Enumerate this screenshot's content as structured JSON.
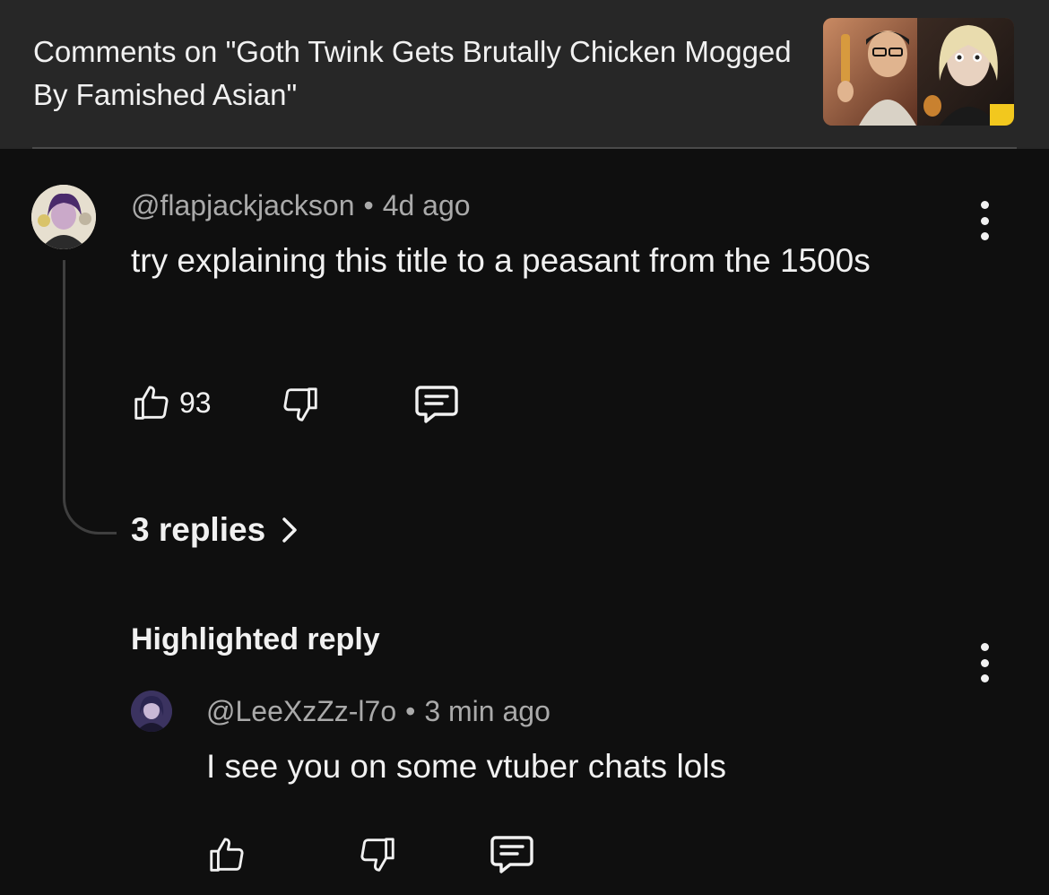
{
  "header": {
    "title": "Comments on \"Goth Twink Gets Brutally Chicken Mogged By Famished Asian\""
  },
  "comment": {
    "author": "@flapjackjackson",
    "separator": "•",
    "time": "4d ago",
    "text": "try explaining this title to a peasant from the 1500s",
    "likes": "93",
    "replies_label": "3 replies"
  },
  "highlighted": {
    "label": "Highlighted reply",
    "author": "@LeeXzZz-l7o",
    "separator": "•",
    "time": "3 min ago",
    "text": "I see you on some vtuber chats lols"
  },
  "icons": {
    "like": "thumbs-up-icon",
    "dislike": "thumbs-down-icon",
    "reply": "comment-icon",
    "more": "more-vert-icon",
    "chevron": "chevron-right-icon"
  },
  "colors": {
    "background": "#0f0f0f",
    "header": "#272727",
    "text": "#f1f1f1",
    "secondary": "#aaaaaa"
  }
}
